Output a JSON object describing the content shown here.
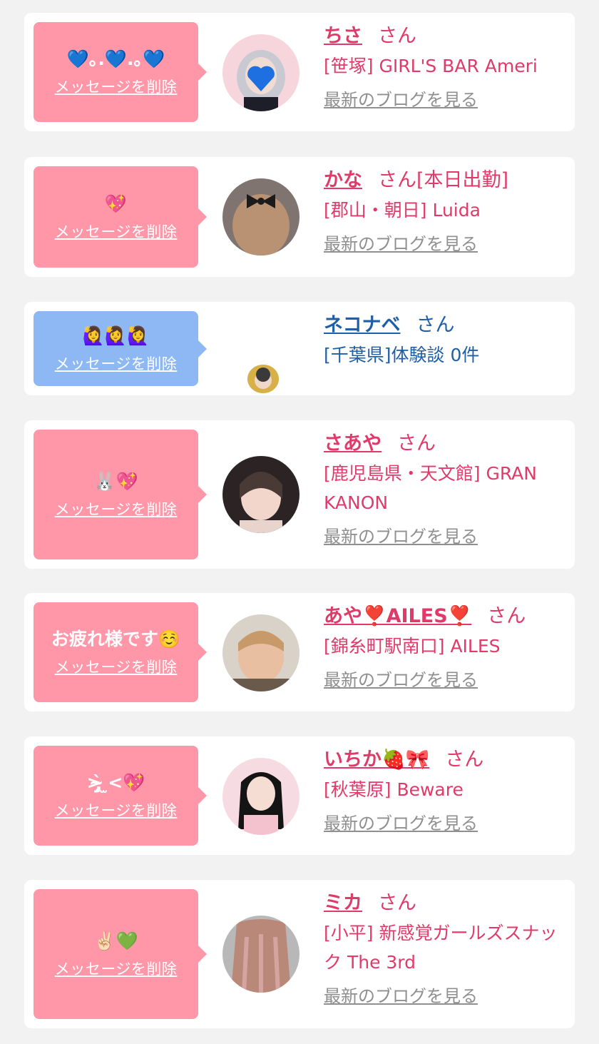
{
  "delete_label": "メッセージを削除",
  "blog_label": "最新のブログを見る",
  "honorific": "さん",
  "colors": {
    "page_bg": "#f2f2f2",
    "bubble_pink": "#ff97a8",
    "bubble_blue": "#8db8f4",
    "name_pink": "#e13a6a",
    "name_blue": "#1f5fa8",
    "link_gray": "#8f8f8f"
  },
  "messages": [
    {
      "message": "💙｡.💙.｡💙",
      "name": "ちさ",
      "after_san": "",
      "shop": "[笹塚] GIRL'S BAR Ameri",
      "bubble": "pink",
      "has_blog": true
    },
    {
      "message": "💖",
      "name": "かな",
      "after_san": "[本日出勤]",
      "shop": "[郡山・朝日] Luida",
      "bubble": "pink",
      "has_blog": true
    },
    {
      "message": "🙋‍♀️🙋‍♀️🙋‍♀️",
      "name": "ネコナベ",
      "after_san": "",
      "shop": "[千葉県]体験談 0件",
      "bubble": "blue",
      "has_blog": false
    },
    {
      "message": "🐰💖",
      "name": "さあや",
      "after_san": "",
      "shop": "[鹿児島県・天文館] GRAN KANON",
      "bubble": "pink",
      "has_blog": true
    },
    {
      "message": "お疲れ様です☺️",
      "name": "あや❣️AILES❣️",
      "after_san": "",
      "shop": "[錦糸町駅南口] AILES",
      "bubble": "pink",
      "has_blog": true
    },
    {
      "message": ">̴̨̡̀ ̫<💖",
      "name": "いちか🍓🎀",
      "after_san": "",
      "shop": "[秋葉原] Beware",
      "bubble": "pink",
      "has_blog": true
    },
    {
      "message": "✌🏻💚",
      "name": "ミカ",
      "after_san": "",
      "shop": "[小平] 新感覚ガールズスナック The 3rd",
      "bubble": "pink",
      "has_blog": true
    }
  ]
}
